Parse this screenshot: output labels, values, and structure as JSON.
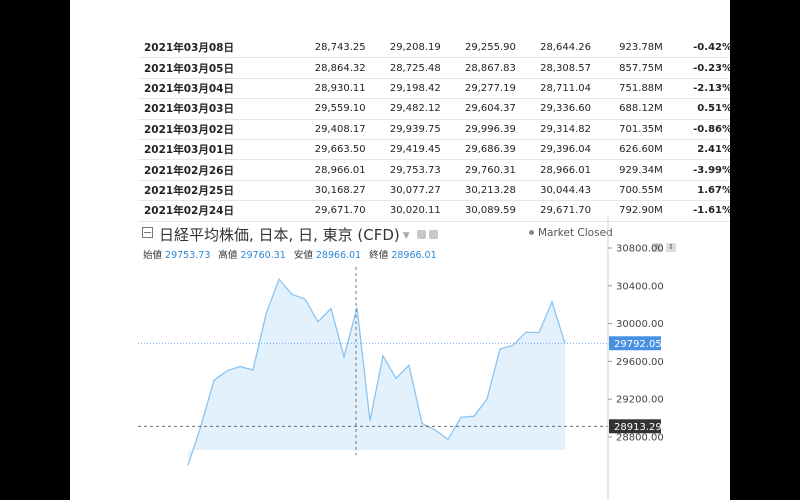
{
  "history": {
    "rows": [
      {
        "date": "2021年03月08日",
        "close": "28,743.25",
        "open": "29,208.19",
        "high": "29,255.90",
        "low": "28,644.26",
        "volume": "923.78M",
        "change": "-0.42%",
        "close_dir": "up",
        "change_dir": "up"
      },
      {
        "date": "2021年03月05日",
        "close": "28,864.32",
        "open": "28,725.48",
        "high": "28,867.83",
        "low": "28,308.57",
        "volume": "857.75M",
        "change": "-0.23%",
        "close_dir": "up",
        "change_dir": "up"
      },
      {
        "date": "2021年03月04日",
        "close": "28,930.11",
        "open": "29,198.42",
        "high": "29,277.19",
        "low": "28,711.04",
        "volume": "751.88M",
        "change": "-2.13%",
        "close_dir": "up",
        "change_dir": "up"
      },
      {
        "date": "2021年03月03日",
        "close": "29,559.10",
        "open": "29,482.12",
        "high": "29,604.37",
        "low": "29,336.60",
        "volume": "688.12M",
        "change": "0.51%",
        "close_dir": "dn",
        "change_dir": "dn"
      },
      {
        "date": "2021年03月02日",
        "close": "29,408.17",
        "open": "29,939.75",
        "high": "29,996.39",
        "low": "29,314.82",
        "volume": "701.35M",
        "change": "-0.86%",
        "close_dir": "up",
        "change_dir": "up"
      },
      {
        "date": "2021年03月01日",
        "close": "29,663.50",
        "open": "29,419.45",
        "high": "29,686.39",
        "low": "29,396.04",
        "volume": "626.60M",
        "change": "2.41%",
        "close_dir": "dn",
        "change_dir": "dn"
      },
      {
        "date": "2021年02月26日",
        "close": "28,966.01",
        "open": "29,753.73",
        "high": "29,760.31",
        "low": "28,966.01",
        "volume": "929.34M",
        "change": "-3.99%",
        "close_dir": "up",
        "change_dir": "up"
      },
      {
        "date": "2021年02月25日",
        "close": "30,168.27",
        "open": "30,077.27",
        "high": "30,213.28",
        "low": "30,044.43",
        "volume": "700.55M",
        "change": "1.67%",
        "close_dir": "dn",
        "change_dir": "dn"
      },
      {
        "date": "2021年02月24日",
        "close": "29,671.70",
        "open": "30,020.11",
        "high": "30,089.59",
        "low": "29,671.70",
        "volume": "792.90M",
        "change": "-1.61%",
        "close_dir": "up",
        "change_dir": "up"
      }
    ]
  },
  "chart": {
    "title": "日経平均株価, 日本, 日, 東京 (CFD)",
    "market_status": "Market Closed",
    "ohlc": {
      "open_label": "始値",
      "open": "29753.73",
      "high_label": "高値",
      "high": "29760.31",
      "low_label": "安値",
      "low": "28966.01",
      "close_label": "終値",
      "close": "28966.01"
    },
    "current_price_label": "29792.05",
    "crosshair_price_label": "28913.29",
    "colors": {
      "line": "#8cc4f0",
      "fill": "#e3f1fc",
      "price_tag": "#4a90e2",
      "crosshair_tag": "#333333",
      "up": "#1a9c1a",
      "down": "#e01b1b"
    }
  },
  "chart_data": {
    "type": "area",
    "title": "日経平均株価, 日本, 日, 東京 (CFD)",
    "ylim": [
      28750,
      31000
    ],
    "y_ticks": [
      28800,
      29200,
      29600,
      30000,
      30400,
      30800
    ],
    "y_tick_labels": [
      "28800.00",
      "29200.00",
      "29600.00",
      "30000.00",
      "30400.00",
      "30800.00"
    ],
    "grid": false,
    "current_price": 29792.05,
    "crosshair_price": 28913.29,
    "series": [
      {
        "values": [
          28500,
          28920,
          29400,
          29500,
          29545,
          29510,
          30100,
          30470,
          30310,
          30260,
          30020,
          30160,
          29650,
          30170,
          28970,
          29660,
          29420,
          29560,
          28945,
          28875,
          28775,
          29010,
          29020,
          29200,
          29730,
          29770,
          29910,
          29905,
          30230,
          29790
        ]
      }
    ]
  }
}
